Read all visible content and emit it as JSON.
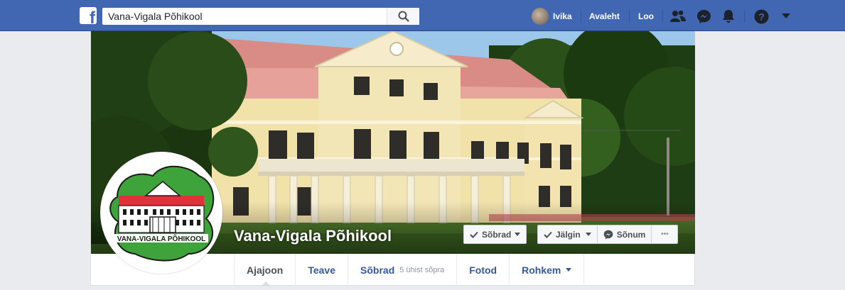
{
  "topbar": {
    "search_value": "Vana-Vigala Põhikool",
    "user_name": "Ivika",
    "home_label": "Avaleht",
    "create_label": "Loo",
    "brand_color": "#4267b2"
  },
  "page": {
    "name": "Vana-Vigala Põhikool",
    "logo_text": "VANA-VIGALA PÕHIKOOL"
  },
  "actions": {
    "friends_label": "Sõbrad",
    "follow_label": "Jälgin",
    "message_label": "Sõnum",
    "more_label": "•••"
  },
  "tabs": [
    {
      "label": "Ajajoon"
    },
    {
      "label": "Teave"
    },
    {
      "label": "Sõbrad",
      "sub": "5 ühist sõpra"
    },
    {
      "label": "Fotod"
    },
    {
      "label": "Rohkem"
    }
  ]
}
